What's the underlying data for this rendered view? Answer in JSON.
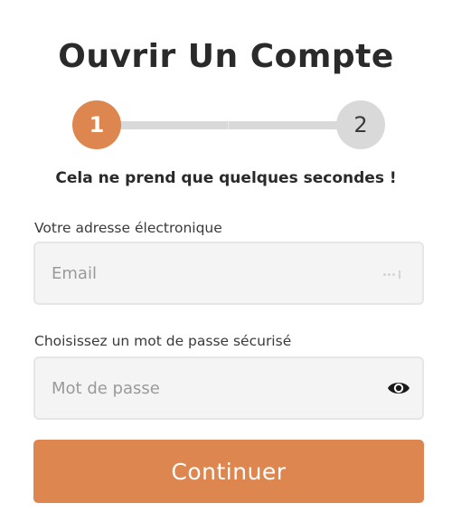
{
  "header": {
    "title": "Ouvrir Un Compte"
  },
  "stepper": {
    "current_step": 1,
    "total_steps": 2,
    "steps": [
      {
        "label": "1",
        "active": true
      },
      {
        "label": "2",
        "active": false
      }
    ]
  },
  "subtitle": "Cela ne prend que quelques secondes !",
  "form": {
    "email": {
      "label": "Votre adresse électronique",
      "placeholder": "Email",
      "value": "",
      "icon": "autofill-dots-icon"
    },
    "password": {
      "label": "Choisissez un mot de passe sécurisé",
      "placeholder": "Mot de passe",
      "value": "",
      "icon": "eye-icon"
    },
    "submit_label": "Continuer"
  },
  "colors": {
    "accent": "#dd8650",
    "inactive_step": "#d9d9d9",
    "text": "#2a2a2a",
    "field_bg": "#f4f4f4"
  }
}
